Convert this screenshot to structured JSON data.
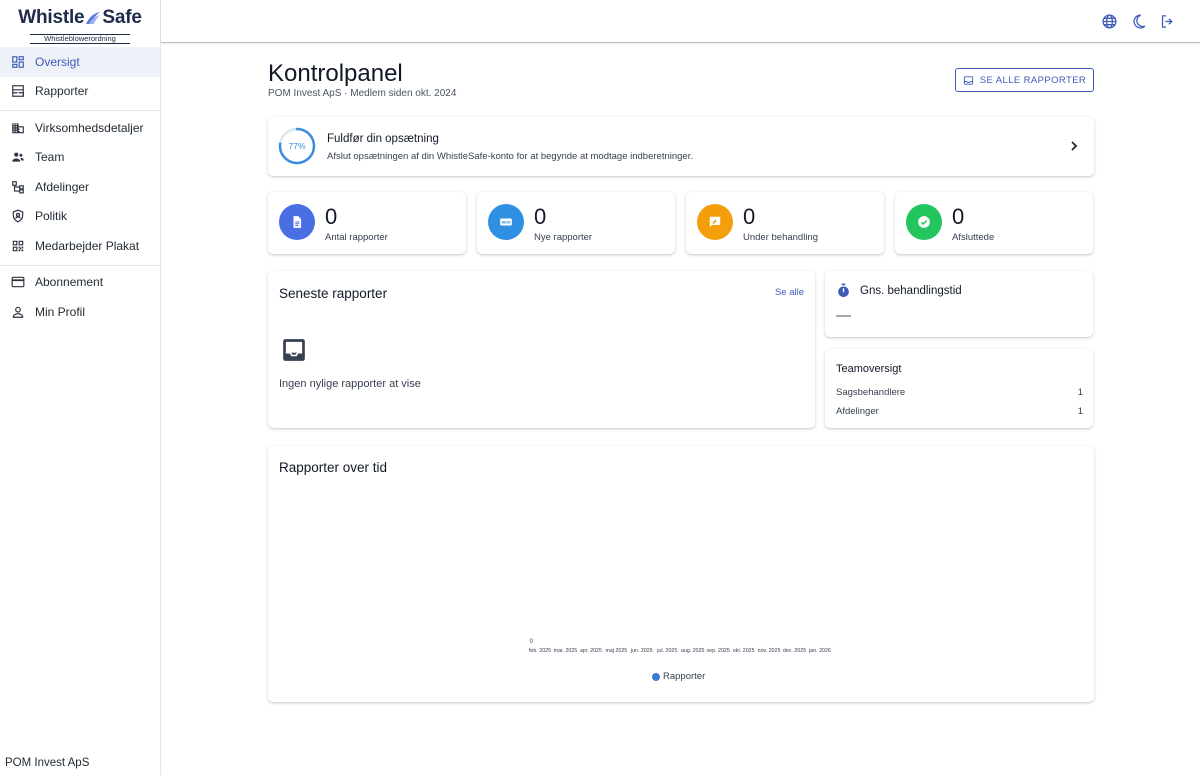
{
  "brand": {
    "name_left": "Whistle",
    "name_right": "Safe",
    "tagline": "Whistleblowerordning"
  },
  "sidebar": {
    "groups": [
      [
        {
          "label": "Oversigt",
          "icon": "dashboard-icon",
          "active": true
        },
        {
          "label": "Rapporter",
          "icon": "reports-icon",
          "active": false
        }
      ],
      [
        {
          "label": "Virksomhedsdetaljer",
          "icon": "building-icon",
          "active": false
        },
        {
          "label": "Team",
          "icon": "people-icon",
          "active": false
        },
        {
          "label": "Afdelinger",
          "icon": "hierarchy-icon",
          "active": false
        },
        {
          "label": "Politik",
          "icon": "shield-icon",
          "active": false
        },
        {
          "label": "Medarbejder Plakat",
          "icon": "qr-code-icon",
          "active": false
        }
      ],
      [
        {
          "label": "Abonnement",
          "icon": "credit-card-icon",
          "active": false
        },
        {
          "label": "Min Profil",
          "icon": "person-icon",
          "active": false
        }
      ]
    ],
    "footer": "POM Invest ApS"
  },
  "topbar": {
    "icons": [
      "globe-icon",
      "moon-icon",
      "logout-icon"
    ]
  },
  "header": {
    "title": "Kontrolpanel",
    "subtitle": "POM Invest ApS · Medlem siden okt. 2024",
    "see_all_button": "SE ALLE RAPPORTER"
  },
  "setup": {
    "progress": 77,
    "progress_label": "77%",
    "title": "Fuldfør din opsætning",
    "description": "Afslut opsætningen af din WhistleSafe-konto for at begynde at modtage indberetninger.",
    "progress_color": "#3a8dde"
  },
  "stats": [
    {
      "value": "0",
      "label": "Antal rapporter",
      "color": "#4a6fe3",
      "icon": "document-icon"
    },
    {
      "value": "0",
      "label": "Nye rapporter",
      "color": "#2f8fe0",
      "icon": "new-badge-icon"
    },
    {
      "value": "0",
      "label": "Under behandling",
      "color": "#f59e0b",
      "icon": "chat-edit-icon"
    },
    {
      "value": "0",
      "label": "Afsluttede",
      "color": "#22c55e",
      "icon": "check-circle-icon"
    }
  ],
  "recent": {
    "title": "Seneste rapporter",
    "see_all": "Se alle",
    "empty_text": "Ingen nylige rapporter at vise"
  },
  "avg_time": {
    "title": "Gns. behandlingstid",
    "value": "—"
  },
  "team": {
    "title": "Teamoversigt",
    "rows": [
      {
        "label": "Sagsbehandlere",
        "value": "1"
      },
      {
        "label": "Afdelinger",
        "value": "1"
      }
    ]
  },
  "chart_data": {
    "type": "line",
    "title": "Rapporter over tid",
    "categories": [
      "feb. 2025",
      "mar. 2025",
      "apr. 2025",
      "maj 2025",
      "jun. 2025",
      "jul. 2025",
      "aug. 2025",
      "sep. 2025",
      "okt. 2025",
      "nov. 2025",
      "dec. 2025",
      "jan. 2026"
    ],
    "series": [
      {
        "name": "Rapporter",
        "values": [
          0,
          0,
          0,
          0,
          0,
          0,
          0,
          0,
          0,
          0,
          0,
          0
        ],
        "color": "#3e78d8"
      }
    ],
    "y_ticks": [
      "0"
    ],
    "legend": "bottom",
    "grid": false
  }
}
